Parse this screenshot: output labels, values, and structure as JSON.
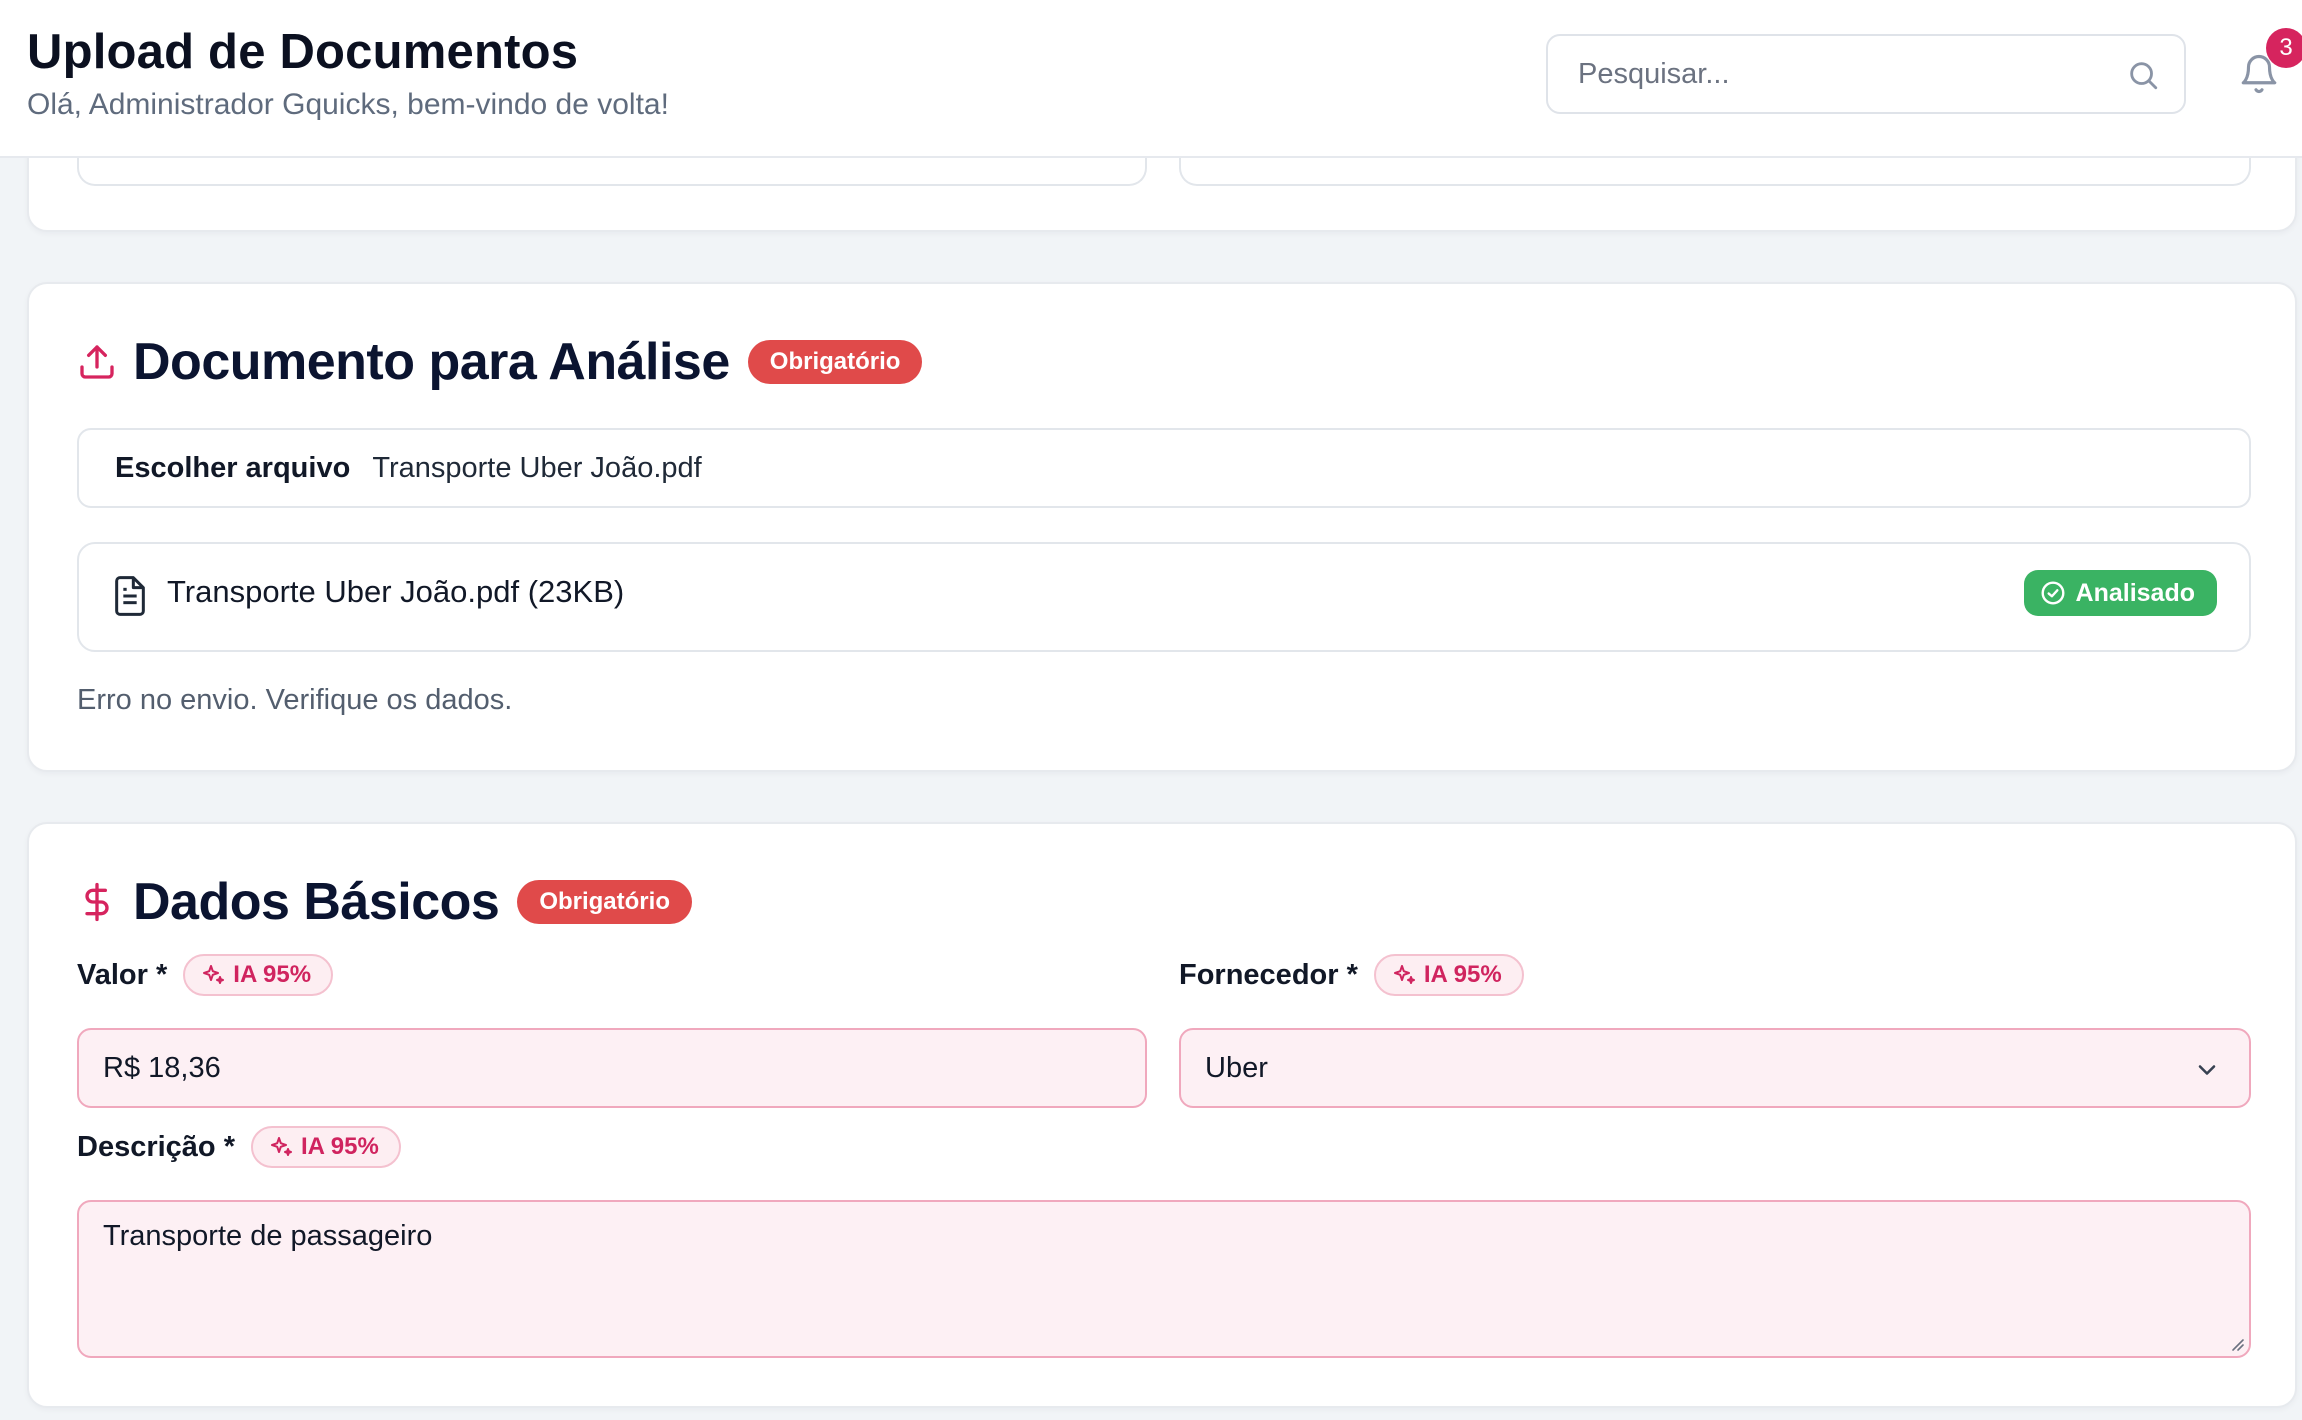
{
  "header": {
    "title": "Upload de Documentos",
    "subtitle": "Olá, Administrador Gquicks, bem-vindo de volta!",
    "search_placeholder": "Pesquisar...",
    "notifications_count": "3"
  },
  "document_section": {
    "title": "Documento para Análise",
    "required_badge": "Obrigatório",
    "choose_file_label": "Escolher arquivo",
    "chosen_file_name": "Transporte Uber João.pdf",
    "uploaded_file": "Transporte Uber João.pdf (23KB)",
    "status": "Analisado",
    "error_message": "Erro no envio. Verifique os dados."
  },
  "basic_section": {
    "title": "Dados Básicos",
    "required_badge": "Obrigatório",
    "valor": {
      "label": "Valor *",
      "ai_badge": "IA 95%",
      "value": "R$ 18,36"
    },
    "fornecedor": {
      "label": "Fornecedor *",
      "ai_badge": "IA 95%",
      "value": "Uber"
    },
    "descricao": {
      "label": "Descrição *",
      "ai_badge": "IA 95%",
      "value": "Transporte de passageiro"
    }
  },
  "colors": {
    "accent": "#d6245e",
    "required_badge": "#e04a4a",
    "success": "#3ab363",
    "ai_field_bg": "#fdf0f4"
  },
  "icons": {
    "upload": "upload-icon",
    "dollar": "dollar-icon",
    "file": "file-text-icon",
    "check": "check-circle-icon",
    "sparkles": "sparkles-icon",
    "search": "search-icon",
    "bell": "bell-icon",
    "chevron": "chevron-down-icon"
  }
}
